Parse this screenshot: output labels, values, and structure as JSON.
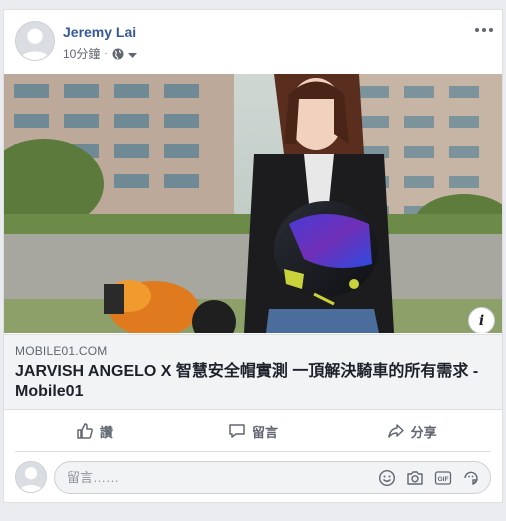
{
  "post": {
    "author": "Jeremy Lai",
    "timestamp": "10分鐘",
    "privacy_separator": "·"
  },
  "link": {
    "domain": "MOBILE01.COM",
    "title": "JARVISH ANGELO X 智慧安全帽實測 一頂解決騎車的所有需求 - Mobile01"
  },
  "actions": {
    "like": "讚",
    "comment": "留言",
    "share": "分享"
  },
  "comment_box": {
    "placeholder": "留言……"
  },
  "colors": {
    "author": "#365899",
    "meta_text": "#606770",
    "card_bg": "#ffffff",
    "page_bg": "#e9ebee"
  },
  "icons": [
    "globe-icon",
    "chevron-down-icon",
    "more-icon",
    "info-icon",
    "like-icon",
    "comment-icon",
    "share-icon",
    "emoji-icon",
    "camera-icon",
    "gif-icon",
    "sticker-icon"
  ]
}
